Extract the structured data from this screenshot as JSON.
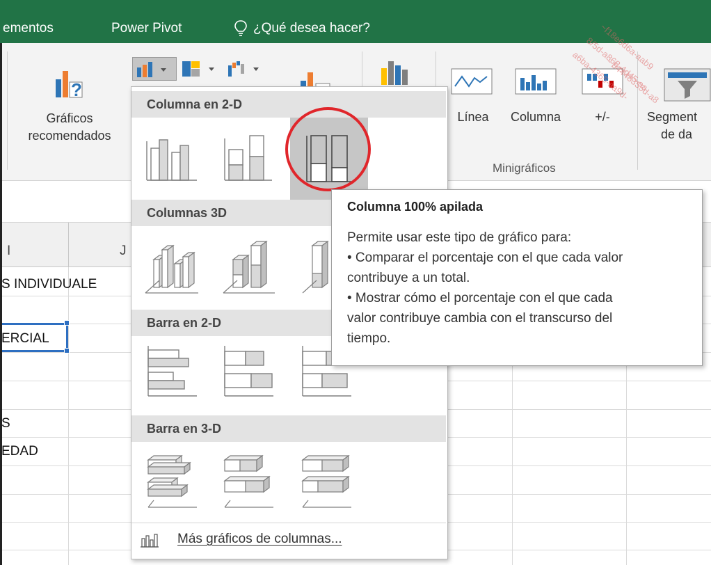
{
  "menubar": {
    "tab_complementos": "ementos",
    "tab_power_pivot": "Power Pivot",
    "tell_me": "¿Qué desea hacer?"
  },
  "ribbon": {
    "recommended_charts_line1": "Gráficos",
    "recommended_charts_line2": "recomendados",
    "sparkline_line": "Línea",
    "sparkline_column": "Columna",
    "sparkline_winloss": "+/-",
    "slicer_line1": "Segment",
    "slicer_line2": "de da",
    "group_sparklines": "Minigráficos"
  },
  "sheet": {
    "col_i": "I",
    "col_j": "J",
    "cells": [
      "S INDIVIDUALE",
      "ERCIAL",
      "S",
      "EDAD"
    ]
  },
  "gallery": {
    "section_column_2d": "Columna en 2-D",
    "section_column_3d": "Columnas 3D",
    "section_bar_2d": "Barra en 2-D",
    "section_bar_3d": "Barra en 3-D",
    "more_charts": "Más gráficos de columnas...",
    "selected_item": "Columna 100% apilada"
  },
  "tooltip": {
    "title": "Columna 100% apilada",
    "lines": [
      "Permite usar este tipo de gráfico para:",
      "• Comparar el porcentaje con el que cada valor",
      "contribuye a un total.",
      "• Mostrar cómo el porcentaje con el que cada",
      "valor contribuye cambia con el transcurso del",
      "tiempo."
    ]
  },
  "colors": {
    "excel_green": "#217346",
    "selection_blue": "#2e6fc1",
    "highlight_red": "#e0262b",
    "chart_blue": "#2e75b6",
    "chart_orange": "#ed7d31",
    "chart_gray": "#a5a5a5",
    "chart_gold": "#ffc000"
  },
  "icons": [
    "lightbulb-icon",
    "recommended-charts-icon",
    "column-chart-icon",
    "hierarchy-chart-icon",
    "waterfall-chart-icon",
    "pivot-chart-icon",
    "3d-map-icon",
    "sparkline-line-icon",
    "sparkline-column-icon",
    "sparkline-winloss-icon",
    "slicer-icon",
    "clustered-column-icon",
    "stacked-column-icon",
    "100-stacked-column-icon",
    "3d-clustered-column-icon",
    "3d-stacked-column-icon",
    "3d-100-stacked-column-icon",
    "clustered-bar-icon",
    "stacked-bar-icon",
    "100-stacked-bar-icon",
    "3d-clustered-bar-icon",
    "3d-stacked-bar-icon",
    "3d-100-stacked-bar-icon",
    "more-column-charts-icon"
  ]
}
